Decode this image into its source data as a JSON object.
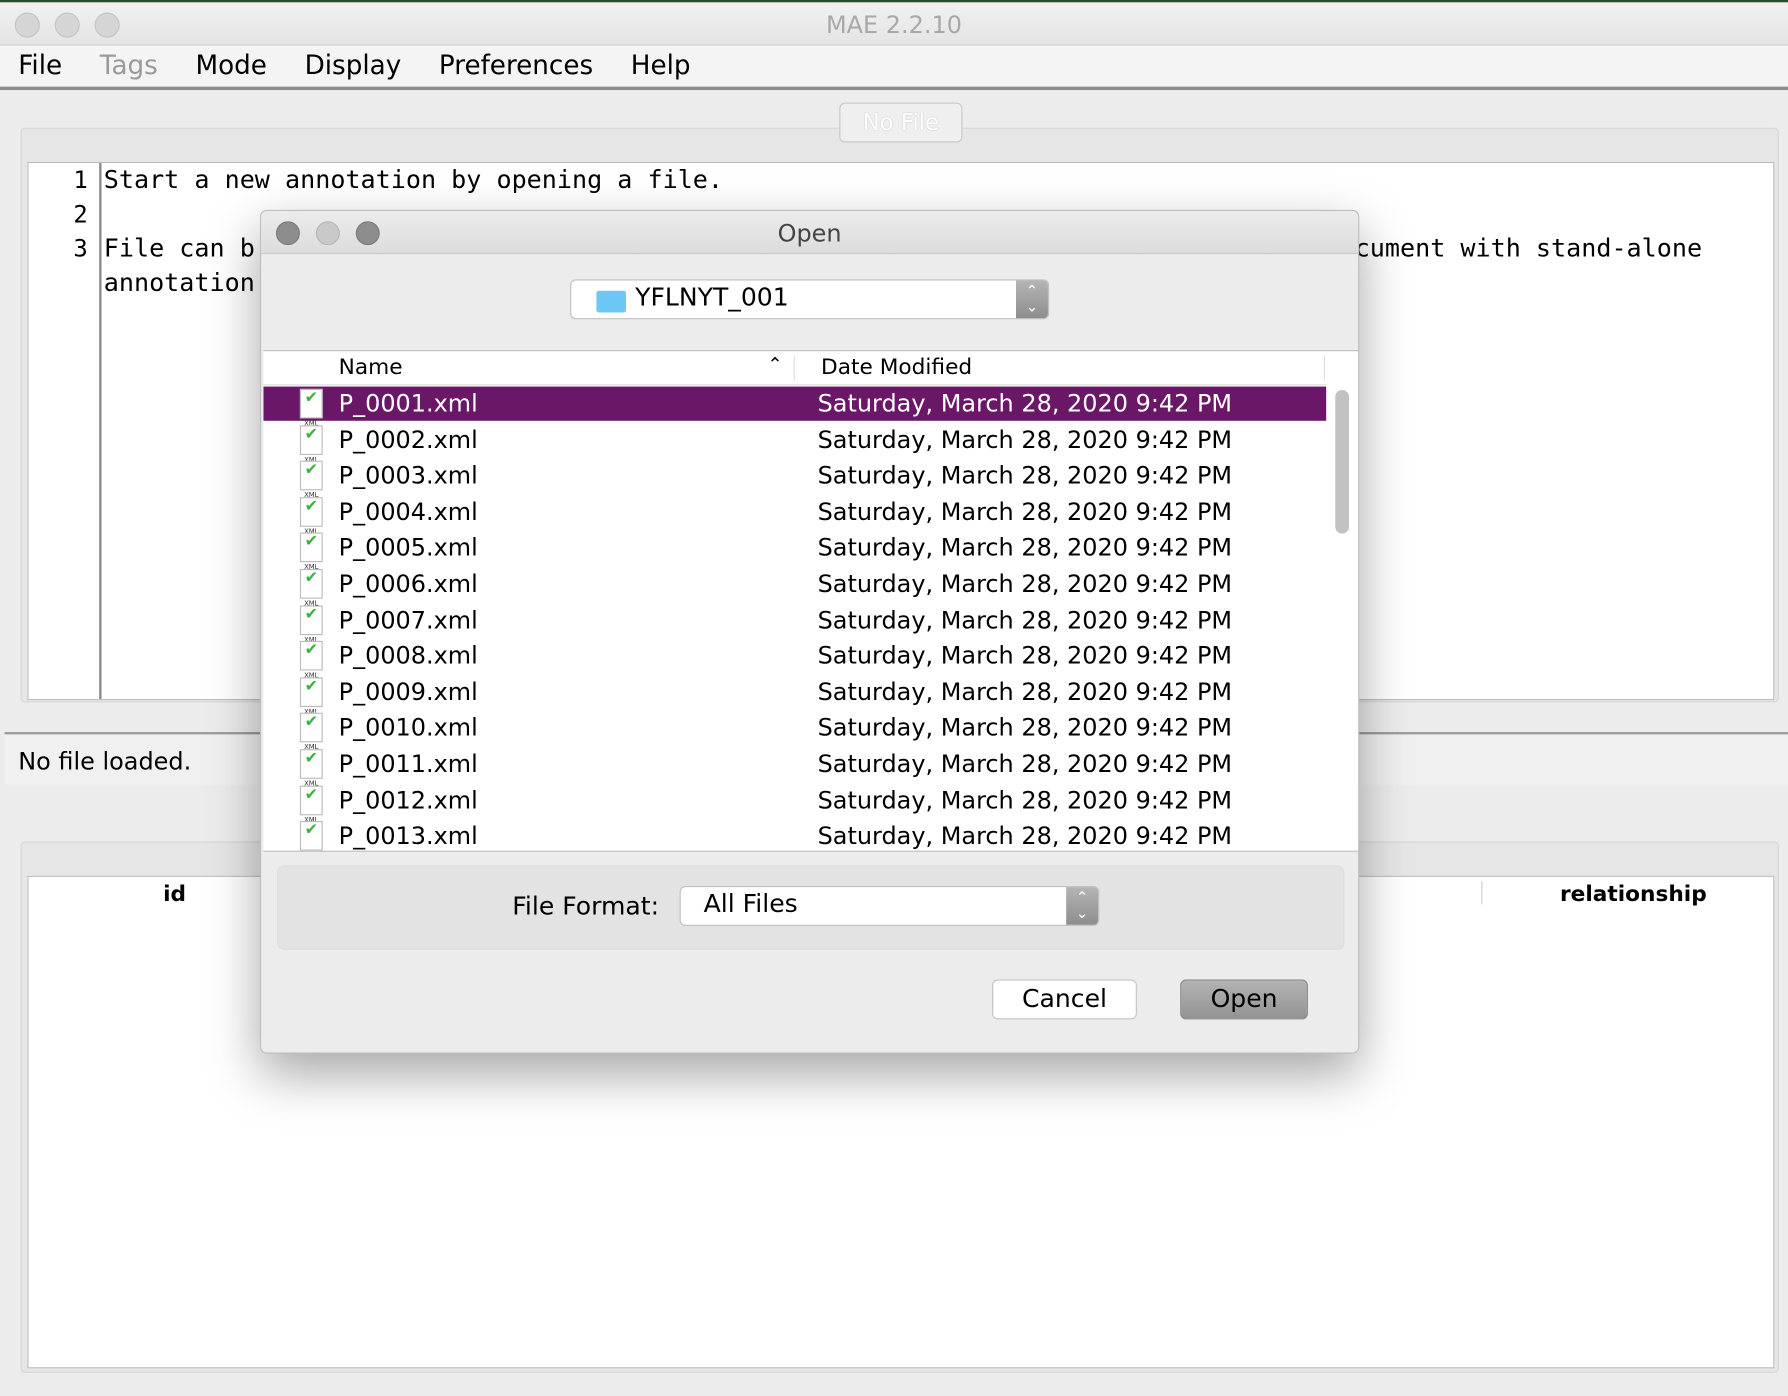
{
  "window": {
    "title": "MAE 2.2.10"
  },
  "menu": [
    {
      "label": "File",
      "enabled": true
    },
    {
      "label": "Tags",
      "enabled": false
    },
    {
      "label": "Mode",
      "enabled": true
    },
    {
      "label": "Display",
      "enabled": true
    },
    {
      "label": "Preferences",
      "enabled": true
    },
    {
      "label": "Help",
      "enabled": true
    }
  ],
  "toolbar": {
    "file_button": "No File"
  },
  "editor": {
    "line_numbers": [
      "1",
      "2",
      "3"
    ],
    "line1": "Start a new annotation by opening a file.",
    "line3_left": "File can b",
    "line3_right": "cument with stand-alone",
    "line4_left": "annotation"
  },
  "status": {
    "text": "No file loaded."
  },
  "table": {
    "columns": [
      "id",
      "relationship"
    ]
  },
  "dialog": {
    "title": "Open",
    "folder": "YFLNYT_001",
    "columns": {
      "name": "Name",
      "date": "Date Modified",
      "sort": "ascending"
    },
    "selected_index": 0,
    "selection_color": "#6a1768",
    "files": [
      {
        "name": "P_0001.xml",
        "date": "Saturday, March 28, 2020 9:42 PM"
      },
      {
        "name": "P_0002.xml",
        "date": "Saturday, March 28, 2020 9:42 PM"
      },
      {
        "name": "P_0003.xml",
        "date": "Saturday, March 28, 2020 9:42 PM"
      },
      {
        "name": "P_0004.xml",
        "date": "Saturday, March 28, 2020 9:42 PM"
      },
      {
        "name": "P_0005.xml",
        "date": "Saturday, March 28, 2020 9:42 PM"
      },
      {
        "name": "P_0006.xml",
        "date": "Saturday, March 28, 2020 9:42 PM"
      },
      {
        "name": "P_0007.xml",
        "date": "Saturday, March 28, 2020 9:42 PM"
      },
      {
        "name": "P_0008.xml",
        "date": "Saturday, March 28, 2020 9:42 PM"
      },
      {
        "name": "P_0009.xml",
        "date": "Saturday, March 28, 2020 9:42 PM"
      },
      {
        "name": "P_0010.xml",
        "date": "Saturday, March 28, 2020 9:42 PM"
      },
      {
        "name": "P_0011.xml",
        "date": "Saturday, March 28, 2020 9:42 PM"
      },
      {
        "name": "P_0012.xml",
        "date": "Saturday, March 28, 2020 9:42 PM"
      },
      {
        "name": "P_0013.xml",
        "date": "Saturday, March 28, 2020 9:42 PM"
      }
    ],
    "file_icon": "xml-file-icon",
    "icon_label": "XML",
    "format_label": "File Format:",
    "format_value": "All Files",
    "cancel": "Cancel",
    "open": "Open"
  }
}
